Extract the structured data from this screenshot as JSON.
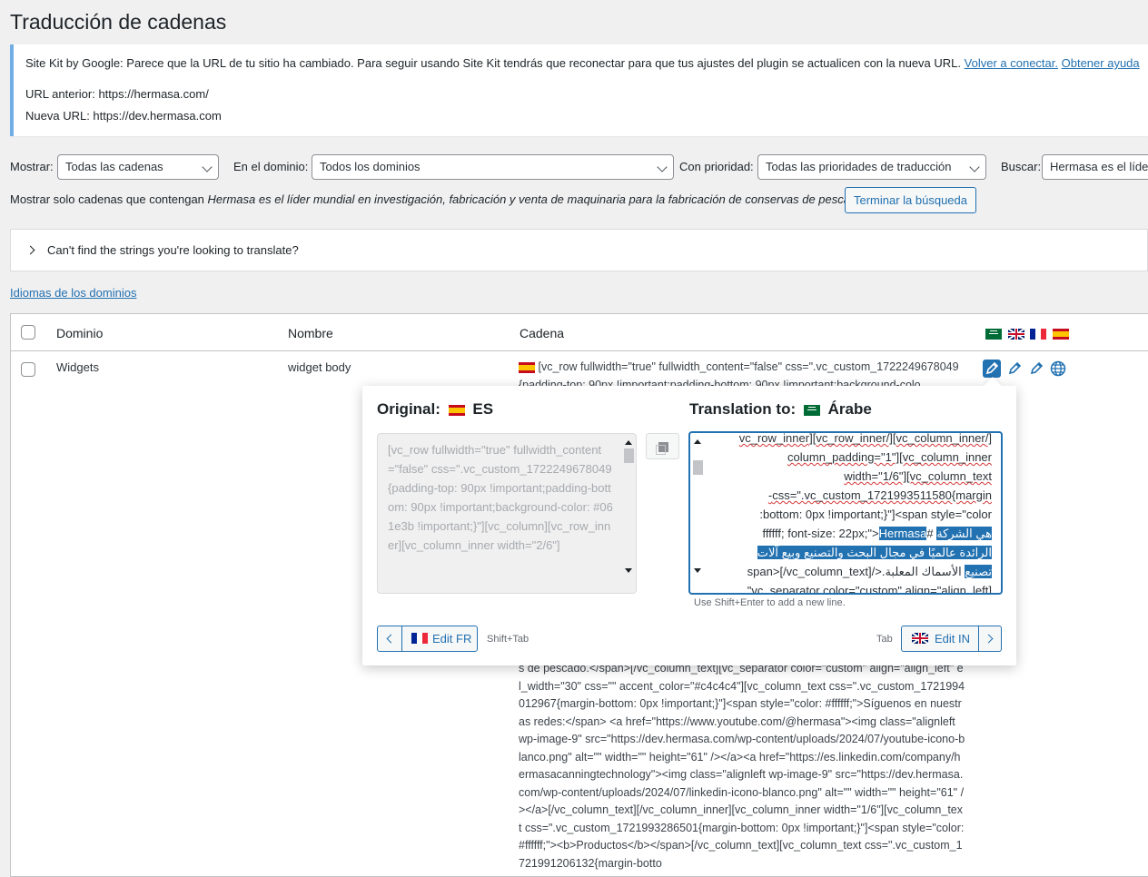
{
  "page": {
    "title": "Traducción de cadenas"
  },
  "notice": {
    "message": "Site Kit by Google: Parece que la URL de tu sitio ha cambiado. Para seguir usando Site Kit tendrás que reconectar para que tus ajustes del plugin se actualicen con la nueva URL.",
    "reconnect_link": "Volver a conectar.",
    "help_link": "Obtener ayuda",
    "old_url": "URL anterior: https://hermasa.com/",
    "new_url": "Nueva URL: https://dev.hermasa.com"
  },
  "filters": {
    "show_label": "Mostrar:",
    "show_value": "Todas las cadenas",
    "domain_label": "En el dominio:",
    "domain_value": "Todos los dominios",
    "priority_label": "Con prioridad:",
    "priority_value": "Todas las prioridades de traducción",
    "search_label": "Buscar:",
    "search_value": "Hermasa es el líder mundial en investigación, fabricación y venta de maquinaria para la fabricación de conservas de pescado",
    "showing_prefix": "Mostrar solo cadenas que contengan ",
    "showing_term": "Hermasa es el líder mundial en investigación, fabricación y venta de maquinaria para la fabricación de conservas de pescado",
    "end_search_button": "Terminar la búsqueda"
  },
  "collapsible": {
    "label": "Can't find the strings you're looking to translate?"
  },
  "domains_link": "Idiomas de los dominios",
  "table": {
    "headers": {
      "domain": "Dominio",
      "name": "Nombre",
      "string": "Cadena"
    },
    "language_flags": [
      "sa-flag-icon",
      "gb-flag-icon",
      "fr-flag-icon",
      "es-flag-icon"
    ],
    "row": {
      "domain": "Widgets",
      "name": "widget body",
      "string_top": "[vc_row fullwidth=\"true\" fullwidth_content=\"false\" css=\".vc_custom_1722249678049{padding-top: 90px !important;padding-bottom: 90px !important;background-colo",
      "string_bottom": "s de pescado.</span>[/vc_column_text][vc_separator color=\"custom\" align=\"align_left\" el_width=\"30\" css=\"\" accent_color=\"#c4c4c4\"][vc_column_text css=\".vc_custom_1721994012967{margin-bottom: 0px !important;}\"]<span style=\"color: #ffffff;\">Síguenos en nuestras redes:</span> <a href=\"https://www.youtube.com/@hermasa\"><img class=\"alignleft wp-image-9\" src=\"https://dev.hermasa.com/wp-content/uploads/2024/07/youtube-icono-blanco.png\" alt=\"\" width=\"\" height=\"61\" /></a><a href=\"https://es.linkedin.com/company/hermasacanningtechnology\"><img class=\"alignleft wp-image-9\" src=\"https://dev.hermasa.com/wp-content/uploads/2024/07/linkedin-icono-blanco.png\" alt=\"\" width=\"\" height=\"61\" /></a>[/vc_column_text][/vc_column_inner][vc_column_inner width=\"1/6\"][vc_column_text css=\".vc_custom_1721993286501{margin-bottom: 0px !important;}\"]<span style=\"color: #ffffff;\"><b>Productos</b></span>[/vc_column_text][vc_column_text css=\".vc_custom_1721991206132{margin-botto"
    }
  },
  "popover": {
    "original_label": "Original:",
    "original_lang": "ES",
    "translation_label": "Translation to:",
    "translation_lang": "Árabe",
    "original_text": "[vc_row fullwidth=\"true\" fullwidth_content=\"false\" css=\".vc_custom_1722249678049{padding-top: 90px !important;padding-bottom: 90px !important;background-color: #061e3b !important;}\"][vc_column][vc_row_inner][vc_column_inner width=\"2/6\"]",
    "translation_lines": {
      "l0": "[/vc_column_inner][/vc_row_inner][vc_row_inner",
      "l1": "column_padding=\"1\"][vc_column_inner",
      "l2": "width=\"1/6\"][vc_column_text",
      "l3": "css=\".vc_custom_1721993511580{margin-",
      "l4": "bottom: 0px !important;}\"]<span style=\"color:",
      "l5_plain": "#ffffff; font-size: 22px;\">",
      "l5_sel_a": "Hermasa",
      "l5_sel_b": "هي الشركة",
      "l6_sel": "الرائدة عالميًا في مجال البحث والتصنيع وبيع آلات",
      "l7_sel": "تصنيع",
      "l7_plain": "الأسماك المعلبة.</span>[/vc_column_text]",
      "l8": "[vc_separator color=\"custom\" align=\"align_left\""
    },
    "hint": "Use Shift+Enter to add a new line.",
    "prev_button": "Edit FR",
    "prev_shortcut": "Shift+Tab",
    "next_button": "Edit IN",
    "next_shortcut": "Tab"
  },
  "colors": {
    "accent": "#2271b1",
    "notice_border": "#72aee6",
    "background": "#f0f0f1"
  }
}
